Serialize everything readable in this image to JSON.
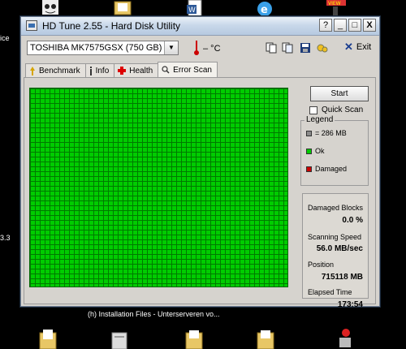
{
  "desktop": {
    "left_texts": [
      "ice",
      "3.3"
    ],
    "bottom_text": "(h) Installation Files - Unterserveren vo..."
  },
  "window": {
    "title": "HD Tune 2.55 - Hard Disk Utility",
    "buttons": {
      "help": "?",
      "minimize": "_",
      "maximize": "□",
      "close": "X"
    }
  },
  "toolbar": {
    "drive": "TOSHIBA MK7575GSX (750 GB)",
    "temperature": "– °C",
    "exit_label": "Exit",
    "icons": [
      "copy-text-icon",
      "copy-info-icon",
      "save-icon",
      "options-icon"
    ]
  },
  "tabs": [
    {
      "label": "Benchmark",
      "icon": "benchmark-icon",
      "active": false
    },
    {
      "label": "Info",
      "icon": "info-icon",
      "active": false
    },
    {
      "label": "Health",
      "icon": "health-icon",
      "active": false
    },
    {
      "label": "Error Scan",
      "icon": "error-scan-icon",
      "active": true
    }
  ],
  "scan": {
    "start_label": "Start",
    "quick_scan_label": "Quick Scan",
    "quick_scan_checked": false,
    "block_status": "all ok",
    "legend": {
      "title": "Legend",
      "items": [
        {
          "label": "= 286 MB",
          "color": "#8c8c8c"
        },
        {
          "label": "Ok",
          "color": "#00cc00"
        },
        {
          "label": "Damaged",
          "color": "#cc0000"
        }
      ]
    },
    "stats": {
      "damaged_label": "Damaged Blocks",
      "damaged_value": "0.0 %",
      "speed_label": "Scanning Speed",
      "speed_value": "56.0 MB/sec",
      "position_label": "Position",
      "position_value": "715118 MB",
      "elapsed_label": "Elapsed Time",
      "elapsed_value": "173:54"
    }
  },
  "colors": {
    "ok_block": "#00cc00",
    "grid_line": "#007a00",
    "window_face": "#d6d3ce"
  }
}
